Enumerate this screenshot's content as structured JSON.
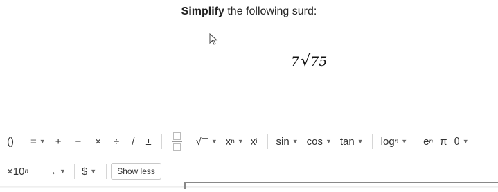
{
  "question": {
    "bold": "Simplify",
    "rest": " the following surd:"
  },
  "expression": {
    "coefficient": "7",
    "radical_symbol": "√",
    "radicand": "75"
  },
  "toolbar": {
    "parens": "()",
    "equals": "=",
    "plus": "+",
    "minus": "−",
    "times": "×",
    "divide": "÷",
    "slash": "/",
    "plusminus": "±",
    "sqrt": "√",
    "power_base": "x",
    "power_exp": "n",
    "subscript_base": "x",
    "subscript_sub": "i",
    "sin": "sin",
    "cos": "cos",
    "tan": "tan",
    "log": "log",
    "log_sub": "n",
    "exp_base": "e",
    "exp_sup": "n",
    "pi": "π",
    "theta": "θ"
  },
  "toolbar2": {
    "sci_prefix": "×10",
    "sci_sup": "n",
    "arrow": "→",
    "dollar": "$",
    "show_less": "Show less"
  }
}
